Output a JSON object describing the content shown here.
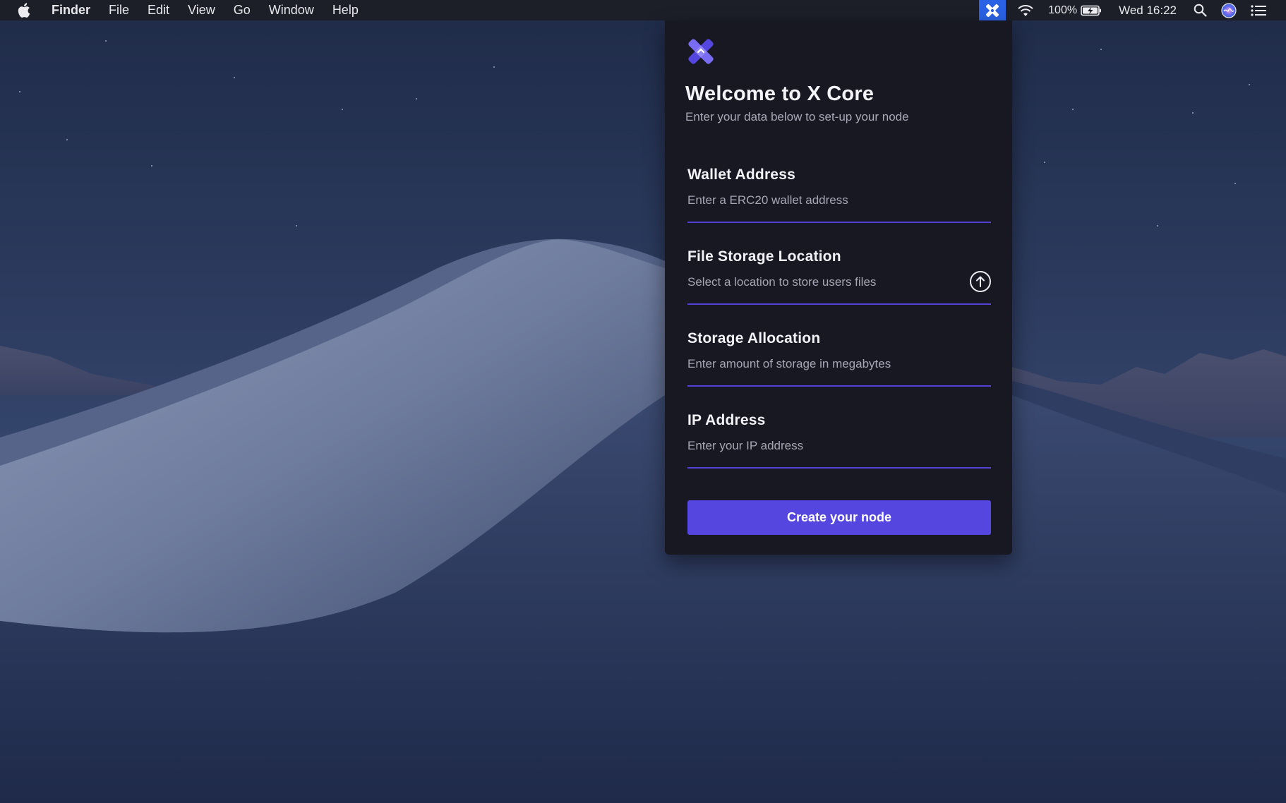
{
  "menubar": {
    "app_name": "Finder",
    "menus": [
      "File",
      "Edit",
      "View",
      "Go",
      "Window",
      "Help"
    ],
    "battery": "100%",
    "clock": "Wed 16:22",
    "icons": [
      "apple-icon",
      "x-core-tray-icon",
      "wifi-icon",
      "battery-charging-icon",
      "spotlight-search-icon",
      "siri-icon",
      "notification-center-icon"
    ]
  },
  "panel": {
    "title": "Welcome to X Core",
    "subtitle": "Enter your data below to set-up your node",
    "fields": [
      {
        "label": "Wallet Address",
        "placeholder": "Enter a ERC20 wallet address",
        "value": ""
      },
      {
        "label": "File Storage Location",
        "placeholder": "Select a location to store users files",
        "value": ""
      },
      {
        "label": "Storage Allocation",
        "placeholder": "Enter amount of storage in megabytes",
        "value": ""
      },
      {
        "label": "IP Address",
        "placeholder": "Enter your IP address",
        "value": ""
      }
    ],
    "submit_label": "Create your node"
  },
  "colors": {
    "accent": "#5646e0",
    "underline": "#5441d6",
    "panel_bg": "#181823",
    "tray_highlight": "#2a62e6"
  }
}
